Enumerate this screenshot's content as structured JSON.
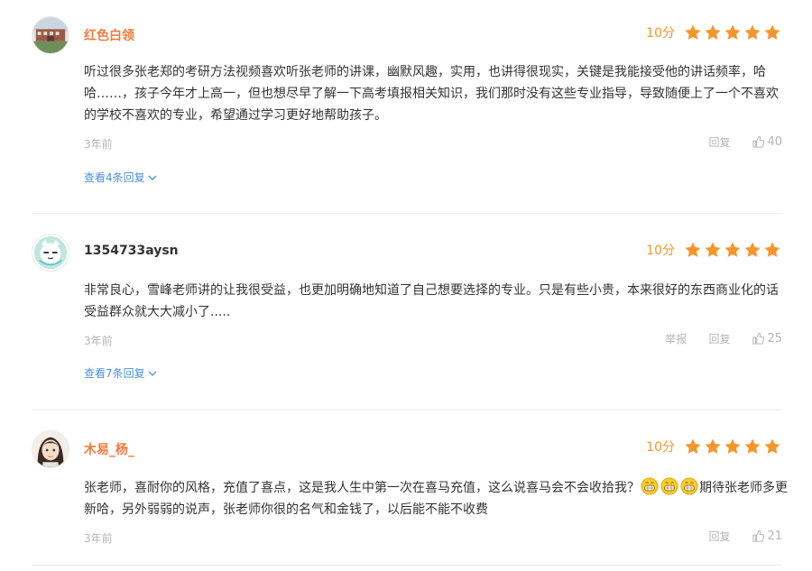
{
  "comments": [
    {
      "username": "红色白领",
      "score": "10分",
      "rating": 5,
      "text": "听过很多张老郑的考研方法视频喜欢听张老师的讲课，幽默风趣，实用，也讲得很现实，关键是我能接受他的讲话频率，哈哈……，孩子今年才上高一，但也想尽早了解一下高考填报相关知识，我们那时没有这些专业指导，导致随便上了一个不喜欢的学校不喜欢的专业，希望通过学习更好地帮助孩子。",
      "time": "3年前",
      "reply_label": "回复",
      "likes": "40",
      "replies_label": "查看4条回复"
    },
    {
      "username": "1354733aysn",
      "score": "10分",
      "rating": 5,
      "text": "非常良心，雪峰老师讲的让我很受益，也更加明确地知道了自己想要选择的专业。只是有些小贵，本来很好的东西商业化的话受益群众就大大减小了.....",
      "time": "3年前",
      "report_label": "举报",
      "reply_label": "回复",
      "likes": "25",
      "replies_label": "查看7条回复"
    },
    {
      "username": "木易_杨_",
      "score": "10分",
      "rating": 5,
      "text_before": "张老师，喜耐你的风格，充值了喜点，这是我人生中第一次在喜马充值，这么说喜马会不会收拾我？",
      "text_after": "期待张老师多更新哈，另外弱弱的说声，张老师你很的名气和金钱了，以后能不能不收费",
      "time": "3年前",
      "reply_label": "回复",
      "likes": "21"
    }
  ],
  "colors": {
    "username": "#f07b3f",
    "score": "#f7952b",
    "star": "#f7952b",
    "link": "#4a90d9",
    "muted": "#b5b5b5"
  },
  "icons": [
    "star-icon",
    "thumbs-up-icon",
    "chevron-down-icon",
    "grin-emoji-icon"
  ]
}
